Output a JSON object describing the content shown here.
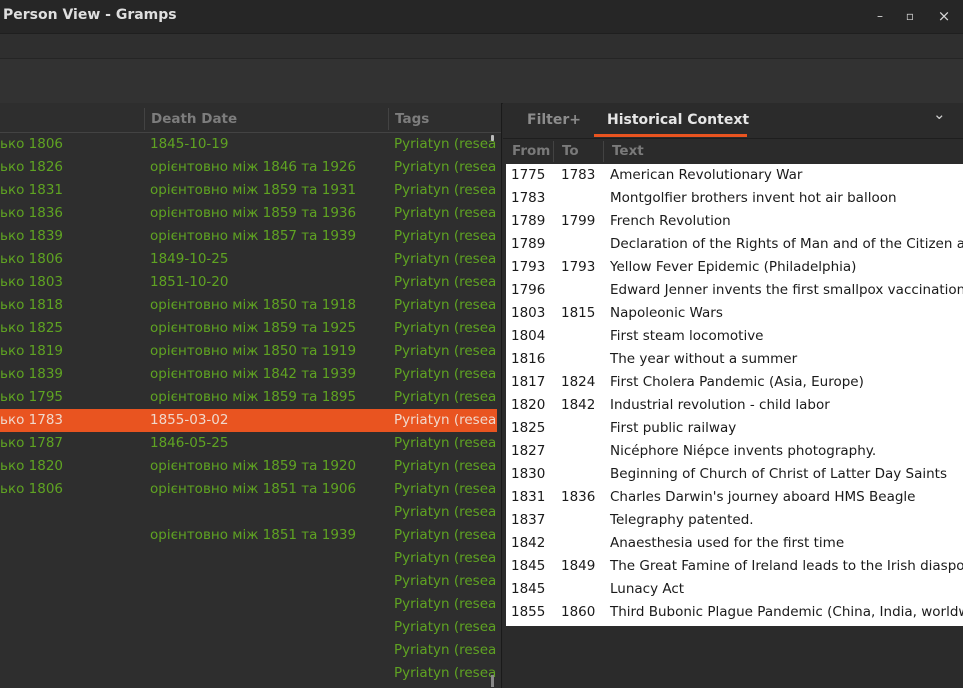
{
  "window": {
    "title": "Person View - Gramps",
    "buttons": {
      "minimize": "–",
      "maximize": "▫",
      "close": "×"
    }
  },
  "people_list": {
    "columns": [
      "Death Date",
      "Tags"
    ],
    "rows": [
      {
        "birth": "ько 1806",
        "death": "1845-10-19",
        "tag": "Pyriatyn (research)",
        "selected": false
      },
      {
        "birth": "ько 1826",
        "death": "орієнтовно між 1846 та 1926",
        "tag": "Pyriatyn (research)",
        "selected": false
      },
      {
        "birth": "ько 1831",
        "death": "орієнтовно між 1859 та 1931",
        "tag": "Pyriatyn (research)",
        "selected": false
      },
      {
        "birth": "ько 1836",
        "death": "орієнтовно між 1859 та 1936",
        "tag": "Pyriatyn (research)",
        "selected": false
      },
      {
        "birth": "ько 1839",
        "death": "орієнтовно між 1857 та 1939",
        "tag": "Pyriatyn (research)",
        "selected": false
      },
      {
        "birth": "ько 1806",
        "death": "1849-10-25",
        "tag": "Pyriatyn (research)",
        "selected": false
      },
      {
        "birth": "ько 1803",
        "death": "1851-10-20",
        "tag": "Pyriatyn (research)",
        "selected": false
      },
      {
        "birth": "ько 1818",
        "death": "орієнтовно між 1850 та 1918",
        "tag": "Pyriatyn (research)",
        "selected": false
      },
      {
        "birth": "ько 1825",
        "death": "орієнтовно між 1859 та 1925",
        "tag": "Pyriatyn (research)",
        "selected": false
      },
      {
        "birth": "ько 1819",
        "death": "орієнтовно між 1850 та 1919",
        "tag": "Pyriatyn (research)",
        "selected": false
      },
      {
        "birth": "ько 1839",
        "death": "орієнтовно між 1842 та 1939",
        "tag": "Pyriatyn (research)",
        "selected": false
      },
      {
        "birth": "ько 1795",
        "death": "орієнтовно між 1859 та 1895",
        "tag": "Pyriatyn (research)",
        "selected": false
      },
      {
        "birth": "ько 1783",
        "death": "1855-03-02",
        "tag": "Pyriatyn (research)",
        "selected": true
      },
      {
        "birth": "ько 1787",
        "death": "1846-05-25",
        "tag": "Pyriatyn (research)",
        "selected": false
      },
      {
        "birth": "ько 1820",
        "death": "орієнтовно між 1859 та 1920",
        "tag": "Pyriatyn (research)",
        "selected": false
      },
      {
        "birth": "ько 1806",
        "death": "орієнтовно між 1851 та 1906",
        "tag": "Pyriatyn (research)",
        "selected": false
      },
      {
        "birth": "",
        "death": "",
        "tag": "Pyriatyn (research)",
        "selected": false
      },
      {
        "birth": "",
        "death": "орієнтовно між 1851 та 1939",
        "tag": "Pyriatyn (research)",
        "selected": false
      },
      {
        "birth": "",
        "death": "",
        "tag": "Pyriatyn (research)",
        "selected": false
      },
      {
        "birth": "",
        "death": "",
        "tag": "Pyriatyn (research)",
        "selected": false
      },
      {
        "birth": "",
        "death": "",
        "tag": "Pyriatyn (research)",
        "selected": false
      },
      {
        "birth": "",
        "death": "",
        "tag": "Pyriatyn (research)",
        "selected": false
      },
      {
        "birth": "",
        "death": "",
        "tag": "Pyriatyn (research)",
        "selected": false
      },
      {
        "birth": "",
        "death": "",
        "tag": "Pyriatyn (research)",
        "selected": false
      }
    ]
  },
  "sidebar": {
    "tabs": [
      {
        "label": "Filter+",
        "active": false
      },
      {
        "label": "Historical Context",
        "active": true
      }
    ],
    "collapse_icon": "chevron-down-icon",
    "columns": [
      "From",
      "To",
      "Text"
    ],
    "events": [
      {
        "from": "1775",
        "to": "1783",
        "text": "American Revolutionary War"
      },
      {
        "from": "1783",
        "to": "",
        "text": "Montgolfier brothers invent hot air balloon"
      },
      {
        "from": "1789",
        "to": "1799",
        "text": "French Revolution"
      },
      {
        "from": "1789",
        "to": "",
        "text": "Declaration of the Rights of Man and of the Citizen adopted"
      },
      {
        "from": "1793",
        "to": "1793",
        "text": "Yellow Fever Epidemic (Philadelphia)"
      },
      {
        "from": "1796",
        "to": "",
        "text": "Edward Jenner invents the first smallpox vaccination"
      },
      {
        "from": "1803",
        "to": "1815",
        "text": "Napoleonic Wars"
      },
      {
        "from": "1804",
        "to": "",
        "text": "First steam locomotive"
      },
      {
        "from": "1816",
        "to": "",
        "text": "The year without a summer"
      },
      {
        "from": "1817",
        "to": "1824",
        "text": "First Cholera Pandemic (Asia, Europe)"
      },
      {
        "from": "1820",
        "to": "1842",
        "text": "Industrial revolution - child labor"
      },
      {
        "from": "1825",
        "to": "",
        "text": "First public railway"
      },
      {
        "from": "1827",
        "to": "",
        "text": "Nicéphore Niépce invents photography."
      },
      {
        "from": "1830",
        "to": "",
        "text": "Beginning of Church of Christ of Latter Day Saints"
      },
      {
        "from": "1831",
        "to": "1836",
        "text": "Charles Darwin's journey aboard HMS Beagle"
      },
      {
        "from": "1837",
        "to": "",
        "text": "Telegraphy patented."
      },
      {
        "from": "1842",
        "to": "",
        "text": "Anaesthesia used for the first time"
      },
      {
        "from": "1845",
        "to": "1849",
        "text": "The Great Famine of Ireland leads to the Irish diaspora"
      },
      {
        "from": "1845",
        "to": "",
        "text": "Lunacy Act"
      },
      {
        "from": "1855",
        "to": "1860",
        "text": "Third Bubonic Plague Pandemic (China, India, worldwide)"
      }
    ]
  },
  "colors": {
    "accent": "#e95420",
    "person_text": "#5fa322",
    "selected_text": "#f0d8cc"
  }
}
